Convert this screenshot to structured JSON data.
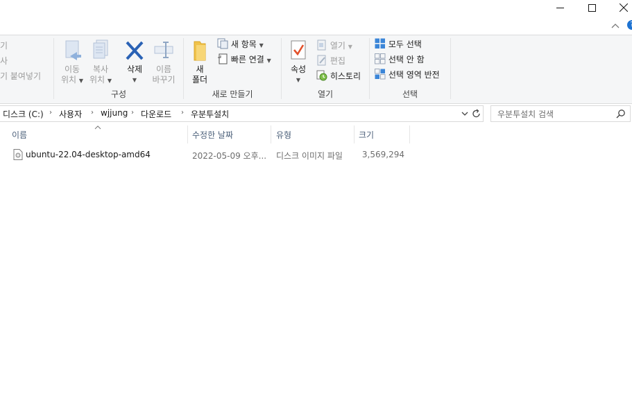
{
  "ribbon": {
    "clipboard_partial": {
      "line1": "기",
      "line2": "사",
      "line3": "기 붙여넣기"
    },
    "organize": {
      "move_to": [
        "이동",
        "위치"
      ],
      "copy_to": [
        "복사",
        "위치"
      ],
      "delete": "삭제",
      "rename": [
        "이름",
        "바꾸기"
      ],
      "group_label": "구성"
    },
    "new": {
      "new_folder": [
        "새",
        "폴더"
      ],
      "new_item": "새 항목",
      "easy_access": "빠른 연결",
      "group_label": "새로 만들기"
    },
    "open": {
      "properties": "속성",
      "open": "열기",
      "edit": "편집",
      "history": "히스토리",
      "group_label": "열기"
    },
    "select": {
      "select_all": "모두 선택",
      "select_none": "선택 안 함",
      "invert_selection": "선택 영역 반전",
      "group_label": "선택"
    },
    "help_badge": "?"
  },
  "address": {
    "crumbs": [
      "디스크 (C:)",
      "사용자",
      "wjjung",
      "다운로드",
      "우분투설치"
    ]
  },
  "search": {
    "placeholder": "우분투설치 검색"
  },
  "columns": {
    "name": "이름",
    "modified": "수정한 날짜",
    "type": "유형",
    "size": "크기"
  },
  "files": [
    {
      "name": "ubuntu-22.04-desktop-amd64",
      "modified": "2022-05-09 오후...",
      "type": "디스크 이미지 파일",
      "size": "3,569,294"
    }
  ],
  "colors": {
    "ribbon_bg": "#f5f6f7",
    "accent": "#1e73d2",
    "header_text": "#4c607a",
    "delete_x": "#2a62b5",
    "folder": "#f0c24a"
  }
}
